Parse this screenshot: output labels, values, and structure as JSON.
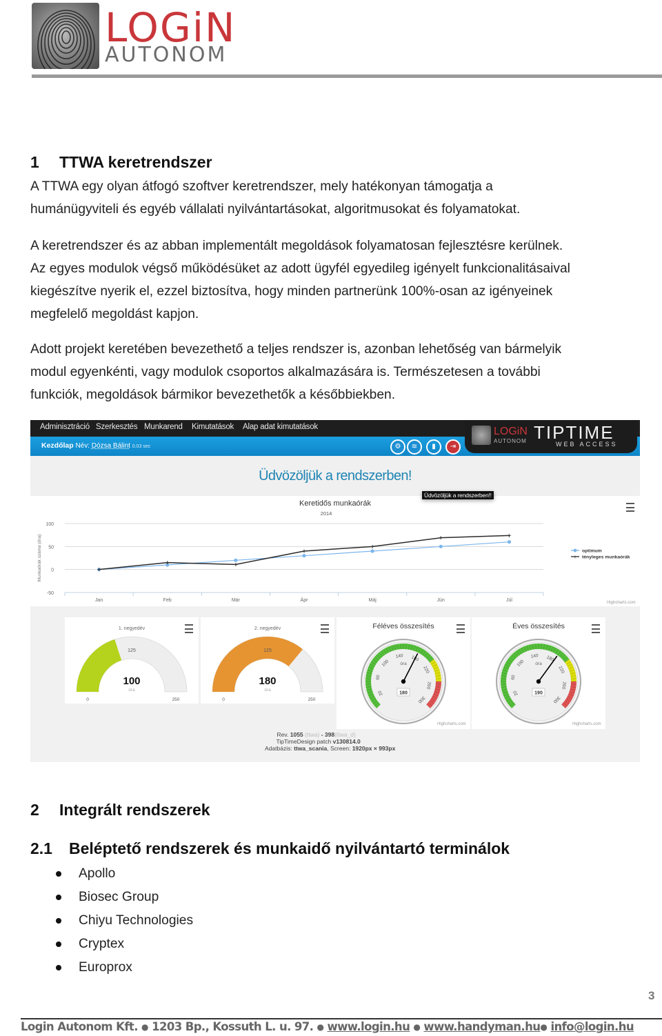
{
  "header": {
    "logo_line1": "LOGiN",
    "logo_line2": "AUTONOM"
  },
  "section1": {
    "number": "1",
    "title": "TTWA keretrendszer",
    "para1": [
      "A TTWA egy olyan átfogó szoftver keretrendszer, mely hatékonyan támogatja a",
      "humánügyviteli és egyéb vállalati nyilvántartásokat, algoritmusokat és folyamatokat."
    ],
    "para2": [
      "A keretrendszer és az abban implementált megoldások folyamatosan fejlesztésre kerülnek.",
      "Az egyes modulok végső működésüket az adott ügyfél egyedileg igényelt funkcionalitásaival",
      "kiegészítve nyerik el, ezzel biztosítva, hogy minden partnerünk 100%-osan az igényeinek",
      "megfelelő megoldást kapjon."
    ],
    "para3": [
      "Adott projekt keretében bevezethető a teljes rendszer is, azonban lehetőség van bármelyik",
      "modul egyenkénti, vagy modulok csoportos alkalmazására is. Természetesen a további",
      "funkciók, megoldások bármikor bevezethetők a későbbiekben."
    ]
  },
  "app_screenshot": {
    "nav": [
      "Adminisztráció",
      "Szerkesztés",
      "Munkarend",
      "Kimutatások",
      "Alap adat kimutatások"
    ],
    "breadcrumb": {
      "page": "Kezdőlap",
      "name_label": "Név:",
      "user": "Dózsa Bálint",
      "time": "0.03 sec"
    },
    "toolbar_icons": [
      "settings-icon",
      "layers-icon",
      "bookmark-icon",
      "logout-icon"
    ],
    "brand": {
      "login": "LOGiN",
      "autonom": "AUTONOM",
      "tiptime": "TIPTIME",
      "web_access": "WEB ACCESS"
    },
    "welcome": "Üdvözöljük a rendszerben!",
    "tooltip": "Üdvözöljük a rendszerben!!",
    "credit": "Highcharts.com",
    "footer": {
      "rev_label": "Rev.",
      "rev": "1055",
      "rev_src": "(ttwa)",
      "rev_sep": "-",
      "rev2": "398",
      "rev2_src": "(ttwa_d)",
      "patch_label": "TipTimeDesign patch",
      "patch": "v130814.0",
      "db_label": "Adatbázis:",
      "db": "ttwa_scania",
      "screen_label": ", Screen:",
      "screen": "1920px × 993px"
    }
  },
  "chart_data": [
    {
      "type": "line",
      "title": "Keretidős munkaórák",
      "subtitle": "2014",
      "xlabel": "",
      "ylabel": "Munkaórák száma (óra)",
      "categories": [
        "Jan",
        "Feb",
        "Már",
        "Ápr",
        "Máj",
        "Jún",
        "Júl"
      ],
      "ylim": [
        -50,
        100
      ],
      "yticks": [
        100,
        50,
        0,
        -50
      ],
      "grid": true,
      "legend": "right",
      "series": [
        {
          "name": "optimum",
          "color": "#7cb5ec",
          "values": [
            0,
            10,
            20,
            30,
            40,
            50,
            60
          ]
        },
        {
          "name": "tényleges munkaórák",
          "color": "#2b2b2b",
          "values": [
            0,
            15,
            11,
            40,
            50,
            69,
            74
          ]
        }
      ]
    },
    {
      "type": "gauge",
      "title": "1. negyedév",
      "value": 100,
      "unit": "óra",
      "min": 0,
      "max": 250,
      "mid_label": "125",
      "color": "#b5d31c"
    },
    {
      "type": "gauge",
      "title": "2. negyedév",
      "value": 180,
      "unit": "óra",
      "min": 0,
      "max": 250,
      "mid_label": "125",
      "color": "#e69432"
    },
    {
      "type": "speedometer",
      "title": "Féléves összesítés",
      "value": 180,
      "unit": "óra",
      "min": 0,
      "max": 300,
      "tick_labels": [
        "20",
        "60",
        "100",
        "140",
        "180",
        "220",
        "260",
        "300"
      ],
      "bands": [
        {
          "from": 0,
          "to": 210,
          "color": "#55bf3b"
        },
        {
          "from": 210,
          "to": 250,
          "color": "#dddf0d"
        },
        {
          "from": 250,
          "to": 300,
          "color": "#df5353"
        }
      ]
    },
    {
      "type": "speedometer",
      "title": "Éves összesítés",
      "value": 190,
      "unit": "óra",
      "min": 0,
      "max": 300,
      "tick_labels": [
        "20",
        "60",
        "100",
        "140",
        "180",
        "220",
        "260",
        "300"
      ],
      "bands": [
        {
          "from": 0,
          "to": 210,
          "color": "#55bf3b"
        },
        {
          "from": 210,
          "to": 250,
          "color": "#dddf0d"
        },
        {
          "from": 250,
          "to": 300,
          "color": "#df5353"
        }
      ]
    }
  ],
  "section2": {
    "number": "2",
    "title": "Integrált rendszerek"
  },
  "section21": {
    "number": "2.1",
    "title": "Beléptető rendszerek és munkaidő nyilvántartó terminálok",
    "items": [
      "Apollo",
      "Biosec Group",
      "Chiyu Technologies",
      "Cryptex",
      "Europrox"
    ]
  },
  "page_number": "3",
  "footer": {
    "company": "Login Autonom Kft.",
    "address": "1203 Bp., Kossuth L. u. 97.",
    "site1": "www.login.hu",
    "site2": "www.handyman.hu",
    "email": "info@login.hu",
    "sep": "●"
  },
  "colors": {
    "brand_red": "#c9363a",
    "nav_blue": "#1b9ee0",
    "welcome_blue": "#1f84b3"
  }
}
